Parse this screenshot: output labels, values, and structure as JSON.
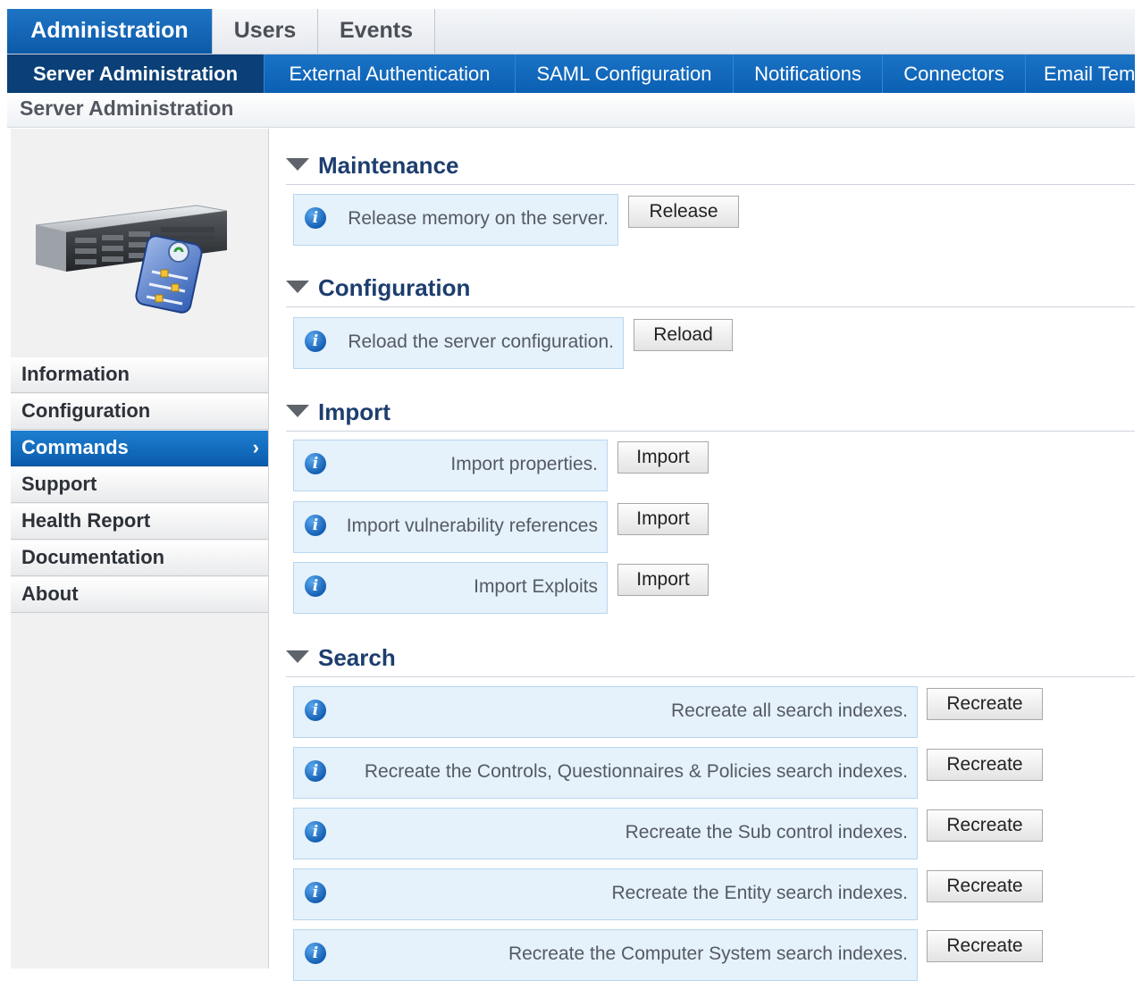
{
  "top_tabs": [
    "Administration",
    "Users",
    "Events"
  ],
  "sub_tabs": [
    "Server Administration",
    "External Authentication",
    "SAML Configuration",
    "Notifications",
    "Connectors",
    "Email Tem"
  ],
  "breadcrumb": "Server Administration",
  "sidebar": {
    "image": "server-settings-icon",
    "items": [
      "Information",
      "Configuration",
      "Commands",
      "Support",
      "Health Report",
      "Documentation",
      "About"
    ],
    "active_chevron": "›"
  },
  "icons": {
    "info": "i"
  },
  "sections": {
    "maintenance": {
      "title": "Maintenance",
      "rows": [
        {
          "text": "Release memory on the server.",
          "button": "Release"
        }
      ]
    },
    "configuration": {
      "title": "Configuration",
      "rows": [
        {
          "text": "Reload the server configuration.",
          "button": "Reload"
        }
      ]
    },
    "import": {
      "title": "Import",
      "rows": [
        {
          "text": "Import properties.",
          "button": "Import"
        },
        {
          "text": "Import vulnerability references",
          "button": "Import"
        },
        {
          "text": "Import Exploits",
          "button": "Import"
        }
      ]
    },
    "search": {
      "title": "Search",
      "rows": [
        {
          "text": "Recreate all search indexes.",
          "button": "Recreate"
        },
        {
          "text": "Recreate the Controls, Questionnaires & Policies search indexes.",
          "button": "Recreate"
        },
        {
          "text": "Recreate the Sub control indexes.",
          "button": "Recreate"
        },
        {
          "text": "Recreate the Entity search indexes.",
          "button": "Recreate"
        },
        {
          "text": "Recreate the Computer System search indexes.",
          "button": "Recreate"
        }
      ]
    }
  },
  "colors": {
    "primary_blue": "#0b5aa8",
    "dark_blue": "#0a3f77",
    "info_bg": "#e5f1fb",
    "heading": "#1d3e6e"
  }
}
